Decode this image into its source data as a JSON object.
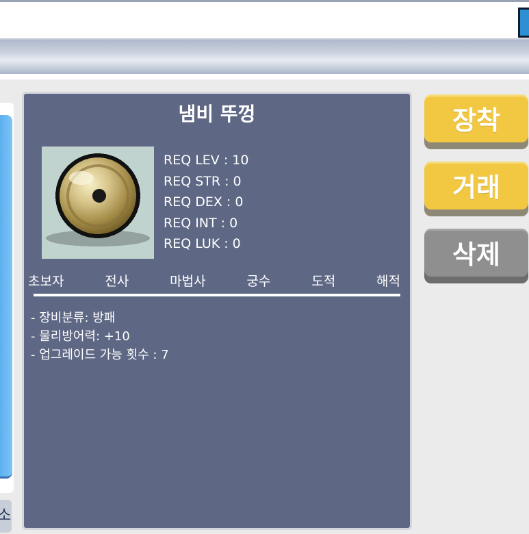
{
  "item": {
    "name": "냄비 뚜껑",
    "icon": "pot-lid-shield-icon"
  },
  "requirements": [
    "REQ LEV : 10",
    "REQ STR : 0",
    "REQ DEX : 0",
    "REQ INT : 0",
    "REQ LUK : 0"
  ],
  "jobs": [
    "초보자",
    "전사",
    "마법사",
    "궁수",
    "도적",
    "해적"
  ],
  "stats": [
    "- 장비분류: 방패",
    "- 물리방어력: +10",
    "- 업그레이드 가능 횟수 : 7"
  ],
  "actions": {
    "equip": "장착",
    "trade": "거래",
    "delete": "삭제"
  },
  "colors": {
    "panel": "#5e6784",
    "button_yellow": "#f2c842",
    "button_gray": "#8f8f8f",
    "scroll_blue": "#5bb1ef"
  }
}
